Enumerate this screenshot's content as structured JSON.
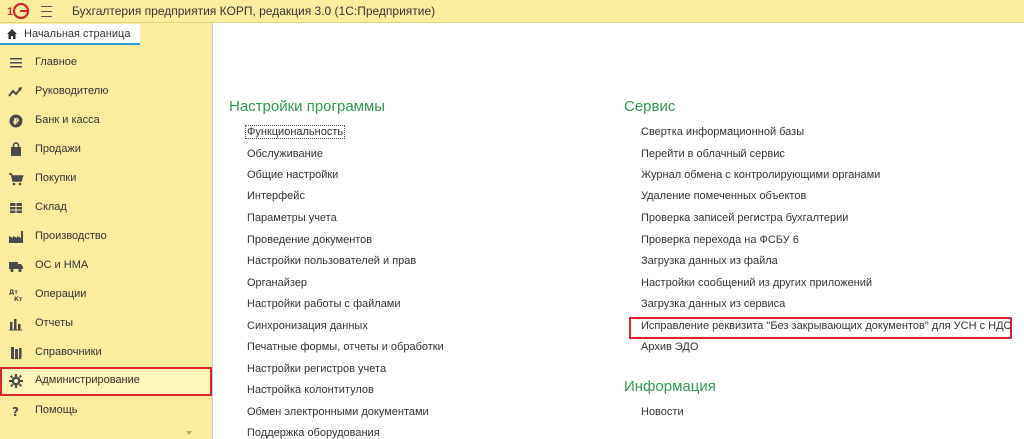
{
  "window": {
    "logo_icon": "1c-logo-icon",
    "title": "Бухгалтерия предприятия КОРП, редакция 3.0  (1С:Предприятие)"
  },
  "tabs": {
    "home_label": "Начальная страница"
  },
  "sidebar": {
    "items": [
      {
        "label": "Главное",
        "icon": "menu-lines-icon"
      },
      {
        "label": "Руководителю",
        "icon": "trend-up-icon"
      },
      {
        "label": "Банк и касса",
        "icon": "ruble-icon"
      },
      {
        "label": "Продажи",
        "icon": "shopping-bag-icon"
      },
      {
        "label": "Покупки",
        "icon": "cart-icon"
      },
      {
        "label": "Склад",
        "icon": "warehouse-grid-icon"
      },
      {
        "label": "Производство",
        "icon": "factory-icon"
      },
      {
        "label": "ОС и НМА",
        "icon": "truck-icon"
      },
      {
        "label": "Операции",
        "icon": "dt-kt-icon"
      },
      {
        "label": "Отчеты",
        "icon": "bar-chart-icon"
      },
      {
        "label": "Справочники",
        "icon": "books-icon"
      },
      {
        "label": "Администрирование",
        "icon": "gear-icon",
        "selected": true
      },
      {
        "label": "Помощь",
        "icon": "question-icon"
      }
    ]
  },
  "settings": {
    "title": "Настройки программы",
    "links": [
      "Функциональность",
      "Обслуживание",
      "Общие настройки",
      "Интерфейс",
      "Параметры учета",
      "Проведение документов",
      "Настройки пользователей и прав",
      "Органайзер",
      "Настройки работы с файлами",
      "Синхронизация данных",
      "Печатные формы, отчеты и обработки",
      "Настройки регистров учета",
      "Настройка колонтитулов",
      "Обмен электронными документами",
      "Поддержка оборудования"
    ]
  },
  "service": {
    "title": "Сервис",
    "links": [
      "Свертка информационной базы",
      "Перейти в облачный сервис",
      "Журнал обмена с контролирующими органами",
      "Удаление помеченных объектов",
      "Проверка записей регистра бухгалтерии",
      "Проверка перехода на ФСБУ 6",
      "Загрузка данных из файла",
      "Настройки сообщений из других приложений",
      "Загрузка данных из сервиса",
      "Исправление реквизита \"Без закрывающих документов\" для УСН с НДС",
      "Архив ЭДО"
    ]
  },
  "info": {
    "title": "Информация",
    "links": [
      "Новости"
    ]
  },
  "colors": {
    "accent_green": "#2e9c4a",
    "panel_yellow": "#fbed9e",
    "highlight_red": "#d8262a",
    "tab_blue": "#2e9cd6"
  }
}
